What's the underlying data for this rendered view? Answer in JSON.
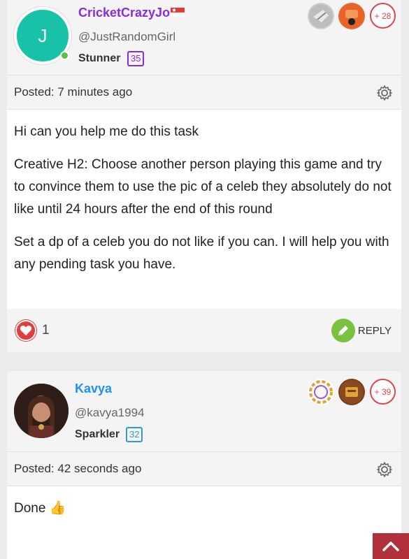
{
  "posts": [
    {
      "author": {
        "name": "CricketCrazyJo",
        "name_color": "#8a2be2",
        "avatar_letter": "J",
        "handle": "@JustRandomGirl",
        "rank": "Stunner",
        "level": "35",
        "level_color": "#8a2be2",
        "extra_badges": "+ 28",
        "flag": "singapore-flag-icon"
      },
      "posted": "Posted: 7 minutes ago",
      "paragraphs": [
        "Hi can you help me do this task",
        "Creative H2: Choose another person playing this game and try to convince them to use the pic of a celeb they absolutely do not like until 24 hours after the end of this round",
        "Set a dp of a celeb you do not like if you can. I will help you with any pending task you have."
      ],
      "likes": "1",
      "reply_label": "REPLY"
    },
    {
      "author": {
        "name": "Kavya",
        "name_color": "#1e90ff",
        "handle": "@kavya1994",
        "rank": "Sparkler",
        "level": "32",
        "level_color": "#2f9bd6",
        "extra_badges": "+ 39"
      },
      "posted": "Posted: 42 seconds ago",
      "paragraphs": [
        "Done"
      ],
      "emoji": "👍"
    }
  ]
}
